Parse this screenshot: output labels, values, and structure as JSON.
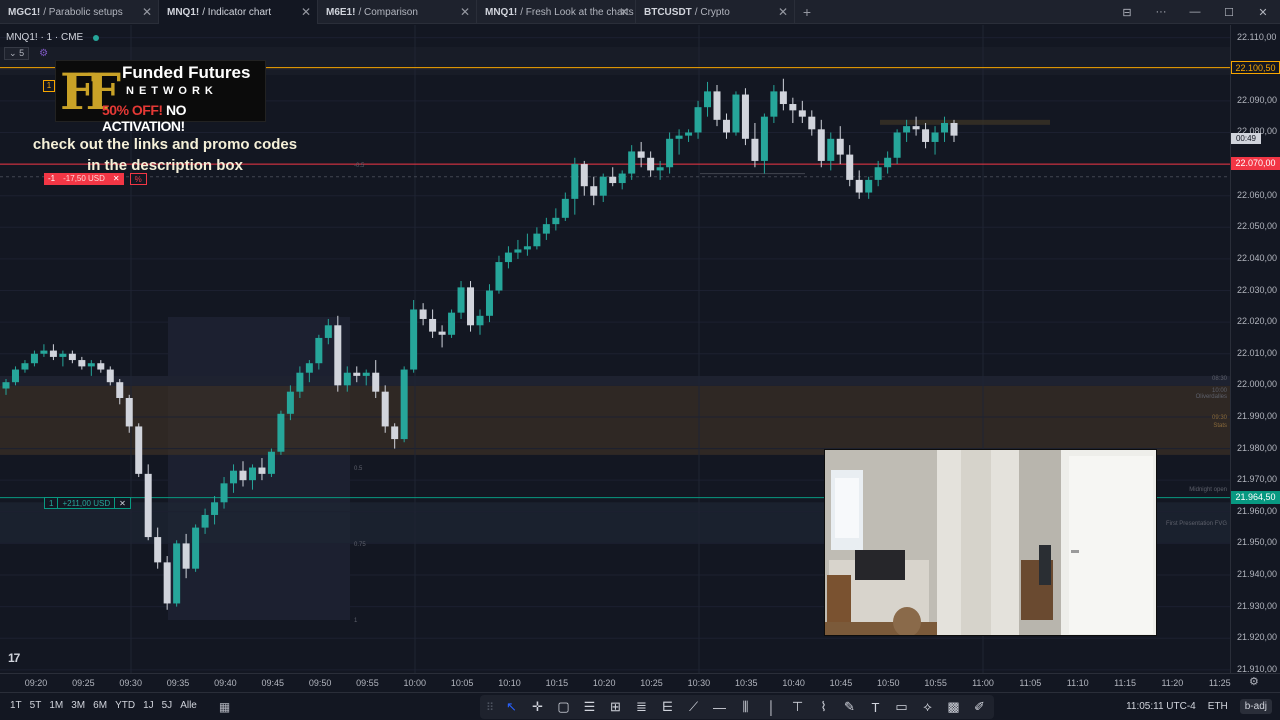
{
  "tabs": [
    {
      "symbol": "MGC1!",
      "title": "Parabolic setups",
      "active": false
    },
    {
      "symbol": "MNQ1!",
      "title": "Indicator chart",
      "active": true
    },
    {
      "symbol": "M6E1!",
      "title": "Comparison",
      "active": false
    },
    {
      "symbol": "MNQ1!",
      "title": "Fresh Look at the charts",
      "active": false
    },
    {
      "symbol": "BTCUSDT",
      "title": "Crypto",
      "active": false
    }
  ],
  "tab_close_glyph": "✕",
  "tab_add_glyph": "+",
  "window_controls": {
    "layout_icon": "layout-icon",
    "more": "···",
    "minimize": "—",
    "maximize": "☐",
    "close": "✕"
  },
  "legend": {
    "symbol": "MNQ1! · 1 · CME",
    "status_color": "#26a69a",
    "indicator_count": "5",
    "indicator_chevron": "⌄"
  },
  "promo": {
    "logo_letters": "FF",
    "brand_line1": "Funded Futures",
    "brand_line2": "NETWORK",
    "offer_red": "50% OFF!",
    "offer_white": "NO ACTIVATION!",
    "text_line1": "check out the links and promo codes",
    "text_line2": "in the description box"
  },
  "orders": {
    "take_profit": {
      "qty": "-1",
      "pnl": "-17,50 USD",
      "close": "✕",
      "pct": "%",
      "price": 22070.0,
      "color": "#f23645"
    },
    "position": {
      "qty": "1",
      "pnl": "+211,00 USD",
      "close": "✕",
      "price": 21964.5,
      "color": "#089981"
    },
    "top_marker": {
      "label": "1",
      "price": 22100.5,
      "color": "#f7a600"
    }
  },
  "price_axis": {
    "ticks": [
      "22.110,00",
      "22.100,50",
      "22.090,00",
      "22.080,00",
      "22.070,00",
      "22.060,00",
      "22.050,00",
      "22.040,00",
      "22.030,00",
      "22.020,00",
      "22.010,00",
      "22.000,00",
      "21.990,00",
      "21.980,00",
      "21.970,00",
      "21.964,50",
      "21.960,00",
      "21.950,00",
      "21.940,00",
      "21.930,00",
      "21.920,00",
      "21.910,00"
    ],
    "badge_orange": "22.100,50",
    "badge_red": "22.070,00",
    "badge_green": "21.964,50",
    "countdown": "00:49"
  },
  "chart_annotations": {
    "fib_m05": "-0.5",
    "fib_05": "0.5",
    "fib_075": "0.75",
    "fib_1": "1",
    "level_0800": "08:30",
    "level_1000": "10:00",
    "level_open": "Oliverdalles",
    "level_0930": "09:30",
    "level_stats": "Stats",
    "midnight_open": "Midnight open",
    "first_fvg": "First Presentation FVG"
  },
  "time_axis": [
    "09:20",
    "09:25",
    "09:30",
    "09:35",
    "09:40",
    "09:45",
    "09:50",
    "09:55",
    "10:00",
    "10:05",
    "10:10",
    "10:15",
    "10:20",
    "10:25",
    "10:30",
    "10:35",
    "10:40",
    "10:45",
    "10:50",
    "10:55",
    "11:00",
    "11:05",
    "11:10",
    "11:15",
    "11:20",
    "11:25"
  ],
  "bottom": {
    "ranges": [
      "1T",
      "5T",
      "1M",
      "3M",
      "6M",
      "YTD",
      "1J",
      "5J",
      "Alle"
    ],
    "clock": "11:05:11 UTC-4",
    "session": "ETH",
    "adj": "b-adj"
  },
  "tv_logo": "17",
  "chart_data": {
    "type": "candlestick",
    "interval": "1m",
    "up_color": "#26a69a",
    "down_color": "#d1d4dc",
    "candles": [
      [
        21999,
        22002,
        21997,
        22001
      ],
      [
        22001,
        22006,
        22000,
        22005
      ],
      [
        22005,
        22008,
        22004,
        22007
      ],
      [
        22007,
        22011,
        22006,
        22010
      ],
      [
        22010,
        22013,
        22009,
        22011
      ],
      [
        22011,
        22013,
        22008,
        22009
      ],
      [
        22009,
        22011,
        22006,
        22010
      ],
      [
        22010,
        22011,
        22007,
        22008
      ],
      [
        22008,
        22009,
        22005,
        22006
      ],
      [
        22006,
        22008,
        22003,
        22007
      ],
      [
        22007,
        22008,
        22004,
        22005
      ],
      [
        22005,
        22006,
        22000,
        22001
      ],
      [
        22001,
        22002,
        21994,
        21996
      ],
      [
        21996,
        21997,
        21985,
        21987
      ],
      [
        21987,
        21988,
        21971,
        21972
      ],
      [
        21972,
        21975,
        21951,
        21952
      ],
      [
        21952,
        21955,
        21942,
        21944
      ],
      [
        21944,
        21946,
        21929,
        21931
      ],
      [
        21931,
        21951,
        21930,
        21950
      ],
      [
        21950,
        21953,
        21939,
        21942
      ],
      [
        21942,
        21956,
        21941,
        21955
      ],
      [
        21955,
        21961,
        21953,
        21959
      ],
      [
        21959,
        21965,
        21956,
        21963
      ],
      [
        21963,
        21971,
        21961,
        21969
      ],
      [
        21969,
        21975,
        21966,
        21973
      ],
      [
        21973,
        21976,
        21968,
        21970
      ],
      [
        21970,
        21975,
        21967,
        21974
      ],
      [
        21974,
        21977,
        21970,
        21972
      ],
      [
        21972,
        21980,
        21971,
        21979
      ],
      [
        21979,
        21992,
        21978,
        21991
      ],
      [
        21991,
        22000,
        21989,
        21998
      ],
      [
        21998,
        22006,
        21996,
        22004
      ],
      [
        22004,
        22008,
        22001,
        22007
      ],
      [
        22007,
        22016,
        22005,
        22015
      ],
      [
        22015,
        22021,
        22013,
        22019
      ],
      [
        22019,
        22022,
        21998,
        22000
      ],
      [
        22000,
        22006,
        21998,
        22004
      ],
      [
        22004,
        22006,
        22001,
        22003
      ],
      [
        22003,
        22005,
        22000,
        22004
      ],
      [
        22004,
        22008,
        21996,
        21998
      ],
      [
        21998,
        22000,
        21985,
        21987
      ],
      [
        21987,
        21988,
        21980,
        21983
      ],
      [
        21983,
        22006,
        21982,
        22005
      ],
      [
        22005,
        22027,
        22004,
        22024
      ],
      [
        22024,
        22026,
        22019,
        22021
      ],
      [
        22021,
        22024,
        22015,
        22017
      ],
      [
        22017,
        22019,
        22012,
        22016
      ],
      [
        22016,
        22024,
        22015,
        22023
      ],
      [
        22023,
        22033,
        22021,
        22031
      ],
      [
        22031,
        22033,
        22017,
        22019
      ],
      [
        22019,
        22024,
        22016,
        22022
      ],
      [
        22022,
        22032,
        22020,
        22030
      ],
      [
        22030,
        22041,
        22029,
        22039
      ],
      [
        22039,
        22044,
        22037,
        22042
      ],
      [
        22042,
        22046,
        22040,
        22043
      ],
      [
        22043,
        22048,
        22041,
        22044
      ],
      [
        22044,
        22050,
        22043,
        22048
      ],
      [
        22048,
        22053,
        22046,
        22051
      ],
      [
        22051,
        22056,
        22049,
        22053
      ],
      [
        22053,
        22061,
        22052,
        22059
      ],
      [
        22059,
        22072,
        22054,
        22070
      ],
      [
        22070,
        22071,
        22060,
        22063
      ],
      [
        22063,
        22066,
        22057,
        22060
      ],
      [
        22060,
        22067,
        22058,
        22066
      ],
      [
        22066,
        22069,
        22063,
        22064
      ],
      [
        22064,
        22068,
        22062,
        22067
      ],
      [
        22067,
        22076,
        22065,
        22074
      ],
      [
        22074,
        22077,
        22069,
        22072
      ],
      [
        22072,
        22074,
        22066,
        22068
      ],
      [
        22068,
        22071,
        22065,
        22069
      ],
      [
        22069,
        22080,
        22067,
        22078
      ],
      [
        22078,
        22081,
        22073,
        22079
      ],
      [
        22079,
        22081,
        22077,
        22080
      ],
      [
        22080,
        22090,
        22078,
        22088
      ],
      [
        22088,
        22096,
        22085,
        22093
      ],
      [
        22093,
        22095,
        22082,
        22084
      ],
      [
        22084,
        22086,
        22078,
        22080
      ],
      [
        22080,
        22093,
        22079,
        22092
      ],
      [
        22092,
        22094,
        22076,
        22078
      ],
      [
        22078,
        22083,
        22069,
        22071
      ],
      [
        22071,
        22086,
        22067,
        22085
      ],
      [
        22085,
        22095,
        22083,
        22093
      ],
      [
        22093,
        22097,
        22087,
        22089
      ],
      [
        22089,
        22091,
        22083,
        22087
      ],
      [
        22087,
        22090,
        22083,
        22085
      ],
      [
        22085,
        22087,
        22079,
        22081
      ],
      [
        22081,
        22084,
        22069,
        22071
      ],
      [
        22071,
        22080,
        22068,
        22078
      ],
      [
        22078,
        22082,
        22070,
        22073
      ],
      [
        22073,
        22076,
        22063,
        22065
      ],
      [
        22065,
        22068,
        22059,
        22061
      ],
      [
        22061,
        22066,
        22059,
        22065
      ],
      [
        22065,
        22071,
        22063,
        22069
      ],
      [
        22069,
        22074,
        22067,
        22072
      ],
      [
        22072,
        22081,
        22070,
        22080
      ],
      [
        22080,
        22084,
        22077,
        22082
      ],
      [
        22082,
        22085,
        22079,
        22081
      ],
      [
        22081,
        22083,
        22075,
        22077
      ],
      [
        22077,
        22082,
        22073,
        22080
      ],
      [
        22080,
        22085,
        22077,
        22083
      ],
      [
        22083,
        22084,
        22077,
        22079
      ]
    ],
    "time_labels": [
      "09:20",
      "09:25",
      "09:30",
      "09:35",
      "09:40",
      "09:45",
      "09:50",
      "09:55",
      "10:00",
      "10:05",
      "10:10",
      "10:15",
      "10:20",
      "10:25",
      "10:30",
      "10:35",
      "10:40",
      "10:45",
      "10:50",
      "10:55",
      "11:00",
      "11:05",
      "11:10",
      "11:15",
      "11:20",
      "11:25"
    ],
    "ylim": [
      21909,
      22114
    ],
    "zones": [
      {
        "from": 21978,
        "to": 22002,
        "color": "#3a2f25"
      },
      {
        "from": 21950,
        "to": 21963,
        "color": "#1e2533"
      }
    ],
    "lines": [
      {
        "price": 22100.5,
        "color": "#f7a600"
      },
      {
        "price": 22070.0,
        "color": "#f23645"
      },
      {
        "price": 21964.5,
        "color": "#089981"
      }
    ]
  }
}
